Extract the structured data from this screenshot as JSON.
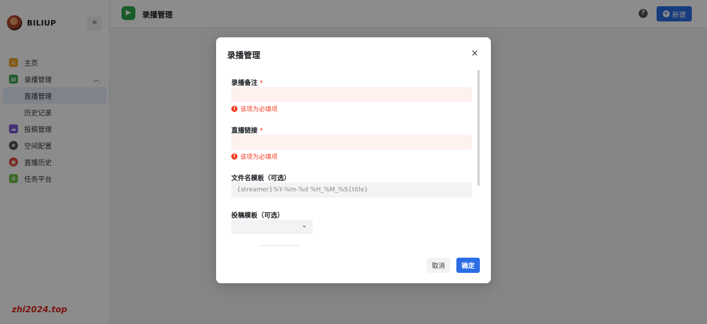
{
  "sidebar": {
    "brand": "BILIUP",
    "collapse_icon": "«",
    "items": [
      {
        "label": "主页",
        "icon": "home-icon",
        "color": "#f0a830"
      },
      {
        "label": "录播管理",
        "icon": "record-icon",
        "color": "#3aa857"
      },
      {
        "label": "直播管理"
      },
      {
        "label": "历史记录"
      },
      {
        "label": "投稿管理",
        "icon": "upload-icon",
        "color": "#7c5cd6"
      },
      {
        "label": "空间配置",
        "icon": "storage-icon",
        "color": "#555555"
      },
      {
        "label": "直播历史",
        "icon": "history-icon",
        "color": "#e0493a"
      },
      {
        "label": "任务平台",
        "icon": "task-icon",
        "color": "#6dc24b"
      }
    ]
  },
  "header": {
    "title": "录播管理",
    "help": "?",
    "new_label": "新建"
  },
  "watermark": "zhi2024.top",
  "modal": {
    "title": "录播管理",
    "close": "×",
    "fields": {
      "note_label": "录播备注",
      "note_error": "该项为必填项",
      "link_label": "直播链接",
      "link_error": "该项为必填项",
      "filename_label": "文件名模板（可选）",
      "filename_placeholder": "{streamer}%Y-%m-%d %H_%M_%S{title}",
      "template_label": "投稿模板（可选）"
    },
    "required_mark": "*",
    "cancel": "取消",
    "confirm": "确定"
  },
  "colors": {
    "primary": "#2b6de5",
    "error": "#f93920"
  }
}
